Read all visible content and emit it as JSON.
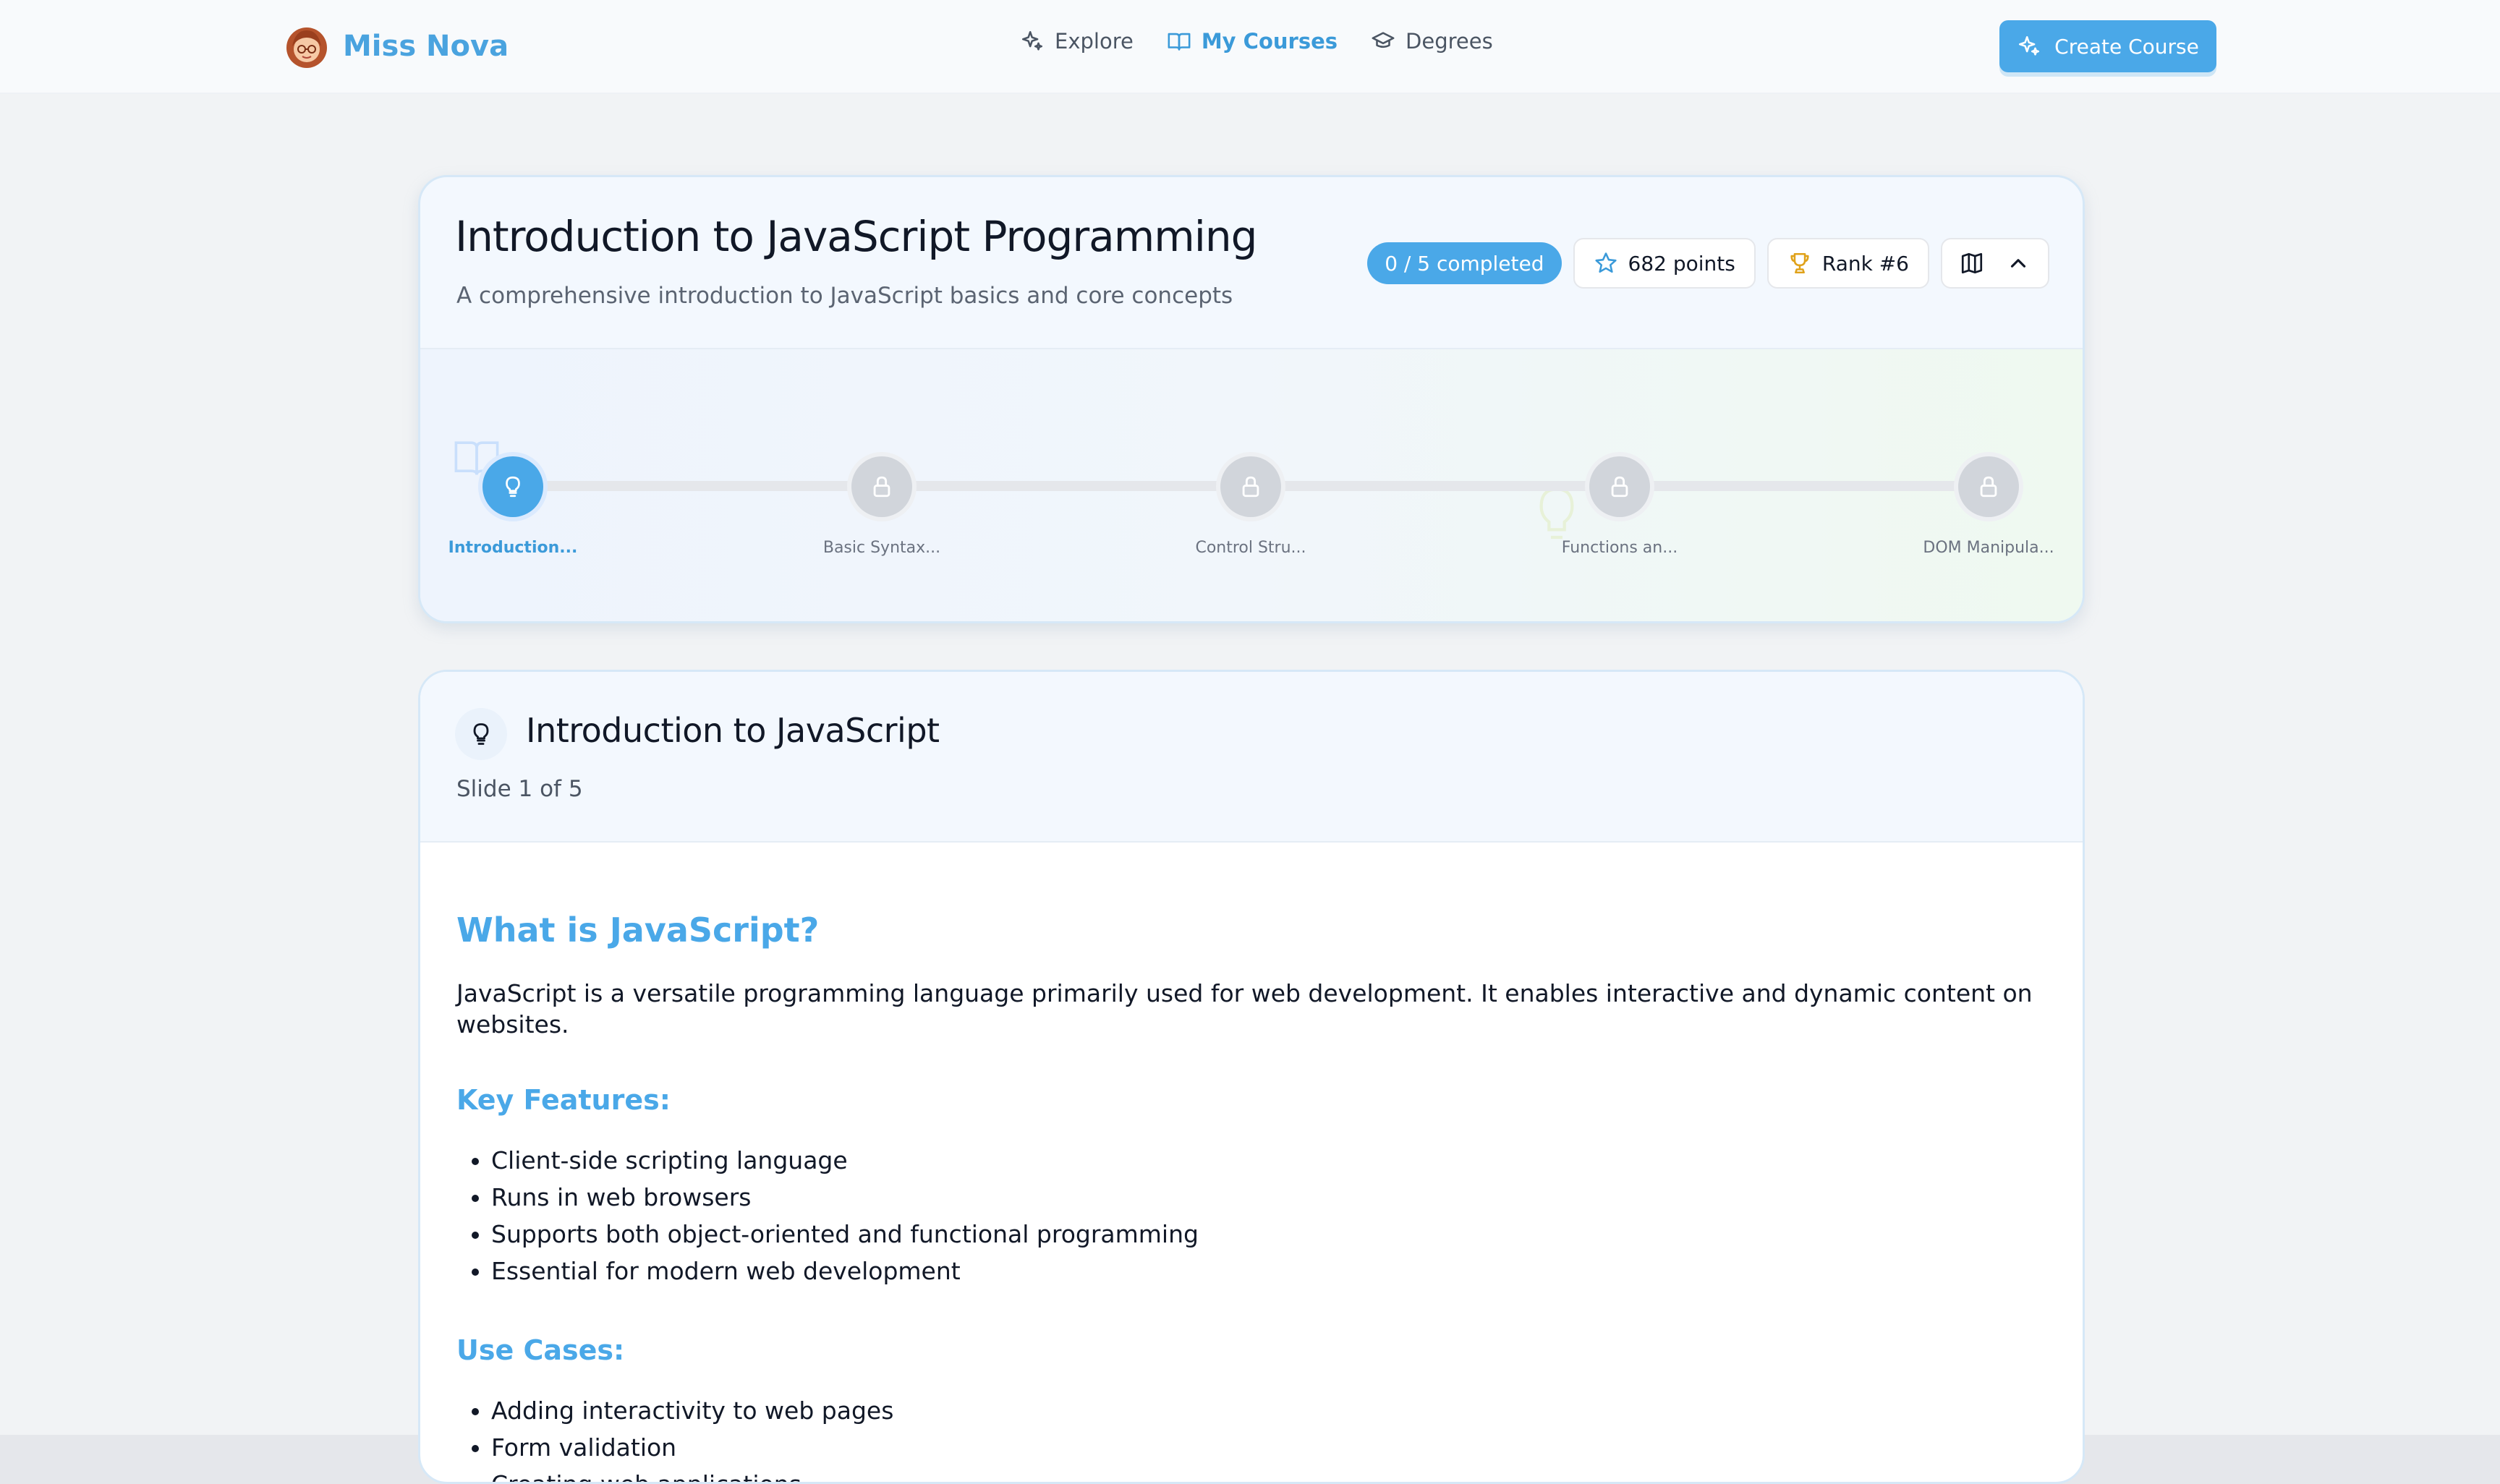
{
  "brand": {
    "name": "Miss Nova"
  },
  "nav": [
    {
      "label": "Explore",
      "icon": "sparkles-icon",
      "active": false
    },
    {
      "label": "My Courses",
      "icon": "book-open-icon",
      "active": true
    },
    {
      "label": "Degrees",
      "icon": "graduation-cap-icon",
      "active": false
    }
  ],
  "create_button": {
    "label": "Create Course"
  },
  "course": {
    "title": "Introduction to JavaScript Programming",
    "description": "A comprehensive introduction to JavaScript basics and core concepts",
    "completed": "0 / 5 completed",
    "points": "682 points",
    "rank": "Rank #6",
    "steps": [
      {
        "label": "Introduction...",
        "state": "active"
      },
      {
        "label": "Basic Syntax...",
        "state": "locked"
      },
      {
        "label": "Control Stru...",
        "state": "locked"
      },
      {
        "label": "Functions an...",
        "state": "locked"
      },
      {
        "label": "DOM Manipula...",
        "state": "locked"
      }
    ]
  },
  "lesson": {
    "title": "Introduction to JavaScript",
    "slide_counter": "Slide 1 of 5",
    "heading": "What is JavaScript?",
    "intro": "JavaScript is a versatile programming language primarily used for web development. It enables interactive and dynamic content on websites.",
    "features_heading": "Key Features:",
    "features": [
      "Client-side scripting language",
      "Runs in web browsers",
      "Supports both object-oriented and functional programming",
      "Essential for modern web development"
    ],
    "use_cases_heading": "Use Cases:",
    "use_cases": [
      "Adding interactivity to web pages",
      "Form validation",
      "Creating web applications"
    ]
  },
  "colors": {
    "accent": "#4aa8e8",
    "locked": "#d1d5db"
  }
}
